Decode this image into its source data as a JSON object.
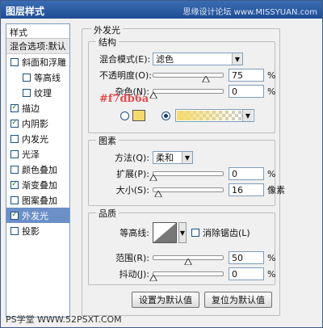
{
  "window": {
    "title": "图层样式",
    "watermark_top": "思缘设计论坛 www.MISSYUAN.com",
    "watermark_bottom": "PS学堂 WWW.52PSXT.COM",
    "accent": "#6b8fc7"
  },
  "left_pane": {
    "header": "样式",
    "blend": "混合选项:默认",
    "items": [
      {
        "label": "斜面和浮雕",
        "checked": false,
        "indent": false
      },
      {
        "label": "等高线",
        "checked": false,
        "indent": true
      },
      {
        "label": "纹理",
        "checked": false,
        "indent": true
      },
      {
        "label": "描边",
        "checked": true,
        "indent": false
      },
      {
        "label": "内阴影",
        "checked": true,
        "indent": false
      },
      {
        "label": "内发光",
        "checked": false,
        "indent": false
      },
      {
        "label": "光泽",
        "checked": false,
        "indent": false
      },
      {
        "label": "颜色叠加",
        "checked": false,
        "indent": false
      },
      {
        "label": "渐变叠加",
        "checked": true,
        "indent": false
      },
      {
        "label": "图案叠加",
        "checked": false,
        "indent": false
      },
      {
        "label": "外发光",
        "checked": true,
        "indent": false,
        "selected": true
      },
      {
        "label": "投影",
        "checked": false,
        "indent": false
      }
    ]
  },
  "outer_glow": {
    "title": "外发光",
    "structure": {
      "title": "结构",
      "blend_mode_label": "混合模式(E):",
      "blend_mode_value": "滤色",
      "opacity_label": "不透明度(O):",
      "opacity_value": "75",
      "opacity_unit": "%",
      "opacity_fraction": 0.75,
      "noise_label": "杂色(N):",
      "noise_value": "0",
      "noise_unit": "%",
      "noise_fraction": 0.0,
      "hex_annotation": "#f7db6a",
      "glow_color": "#f7db6a"
    },
    "elements": {
      "title": "图素",
      "method_label": "方法(Q):",
      "method_value": "柔和",
      "spread_label": "扩展(P):",
      "spread_value": "0",
      "spread_unit": "%",
      "spread_fraction": 0.0,
      "size_label": "大小(S):",
      "size_value": "16",
      "size_unit": "像素",
      "size_fraction": 0.064
    },
    "quality": {
      "title": "品质",
      "contour_label": "等高线:",
      "antialias_label": "消除锯齿(L)",
      "antialias_checked": false,
      "range_label": "范围(R):",
      "range_value": "50",
      "range_unit": "%",
      "range_fraction": 0.5,
      "jitter_label": "抖动(J):",
      "jitter_value": "0",
      "jitter_unit": "%",
      "jitter_fraction": 0.0
    },
    "buttons": {
      "set_default": "设置为默认值",
      "reset_default": "复位为默认值"
    }
  }
}
